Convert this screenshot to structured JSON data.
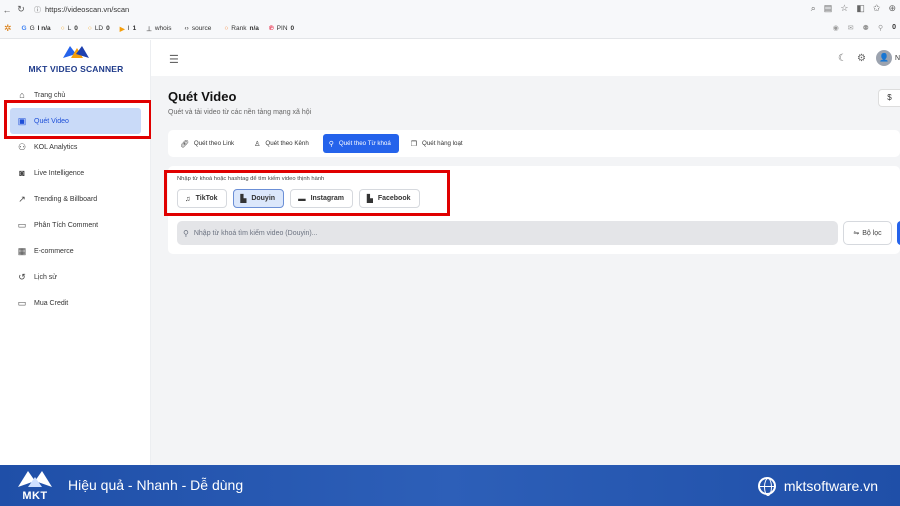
{
  "browser": {
    "url": "https://videoscan.vn/scan",
    "extensions": [
      {
        "icon": "google-icon",
        "label": "G",
        "value": "I n/a",
        "color": "#4285f4"
      },
      {
        "icon": "circle-icon",
        "label": "L",
        "value": "0",
        "color": "#f59e0b"
      },
      {
        "icon": "circle-icon",
        "label": "LD",
        "value": "0",
        "color": "#f59e0b"
      },
      {
        "icon": "bing-icon",
        "label": "I",
        "value": "1",
        "color": "#f59e0b"
      },
      {
        "icon": "whois-icon",
        "label": "whois",
        "value": "",
        "color": "#666666"
      },
      {
        "icon": "code-icon",
        "label": "source",
        "value": "",
        "color": "#666666"
      },
      {
        "icon": "circle-icon",
        "label": "Rank",
        "value": "n/a",
        "color": "#f97316"
      },
      {
        "icon": "pinterest-icon",
        "label": "PIN",
        "value": "0",
        "color": "#e60023"
      }
    ],
    "ext_right_count": "0"
  },
  "brand": {
    "name": "MKT VIDEO SCANNER"
  },
  "sidebar": {
    "items": [
      {
        "label": "Trang chủ",
        "icon": "home-icon",
        "active": false
      },
      {
        "label": "Quét Video",
        "icon": "scan-icon",
        "active": true
      },
      {
        "label": "KOL Analytics",
        "icon": "users-icon",
        "active": false
      },
      {
        "label": "Live Intelligence",
        "icon": "camera-icon",
        "active": false
      },
      {
        "label": "Trending & Billboard",
        "icon": "trend-icon",
        "active": false
      },
      {
        "label": "Phân Tích Comment",
        "icon": "comment-icon",
        "active": false
      },
      {
        "label": "E-commerce",
        "icon": "store-icon",
        "active": false
      },
      {
        "label": "Lịch sử",
        "icon": "history-icon",
        "active": false
      },
      {
        "label": "Mua Credit",
        "icon": "card-icon",
        "active": false
      }
    ]
  },
  "topbar": {
    "user_initial": "N"
  },
  "page": {
    "title": "Quét Video",
    "subtitle": "Quét và tải video từ các nền tảng mạng xã hội",
    "dollar_label": "$"
  },
  "tabs": [
    {
      "label": "Quét theo Link",
      "icon": "link-icon",
      "active": false
    },
    {
      "label": "Quét theo Kênh",
      "icon": "user-icon",
      "active": false
    },
    {
      "label": "Quét theo Từ khoá",
      "icon": "search-icon",
      "active": true
    },
    {
      "label": "Quét hàng loạt",
      "icon": "copy-icon",
      "active": false
    }
  ],
  "keyword": {
    "hint": "Nhập từ khoá hoặc hashtag để tìm kiếm video thịnh hành",
    "platforms": [
      {
        "label": "TikTok",
        "icon": "music-icon",
        "active": false
      },
      {
        "label": "Douyin",
        "icon": "douyin-icon",
        "active": true
      },
      {
        "label": "Instagram",
        "icon": "instagram-icon",
        "active": false
      },
      {
        "label": "Facebook",
        "icon": "facebook-icon",
        "active": false
      }
    ],
    "search_placeholder": "Nhập từ khoá tìm kiếm video (Douyin)...",
    "filter_label": "Bộ lọc"
  },
  "footer": {
    "logo_text": "MKT",
    "slogan": "Hiệu quả - Nhanh - Dễ dùng",
    "site": "mktsoftware.vn"
  },
  "colors": {
    "accent": "#2563eb",
    "highlight": "#e00000",
    "footer": "#1f4fa8"
  }
}
